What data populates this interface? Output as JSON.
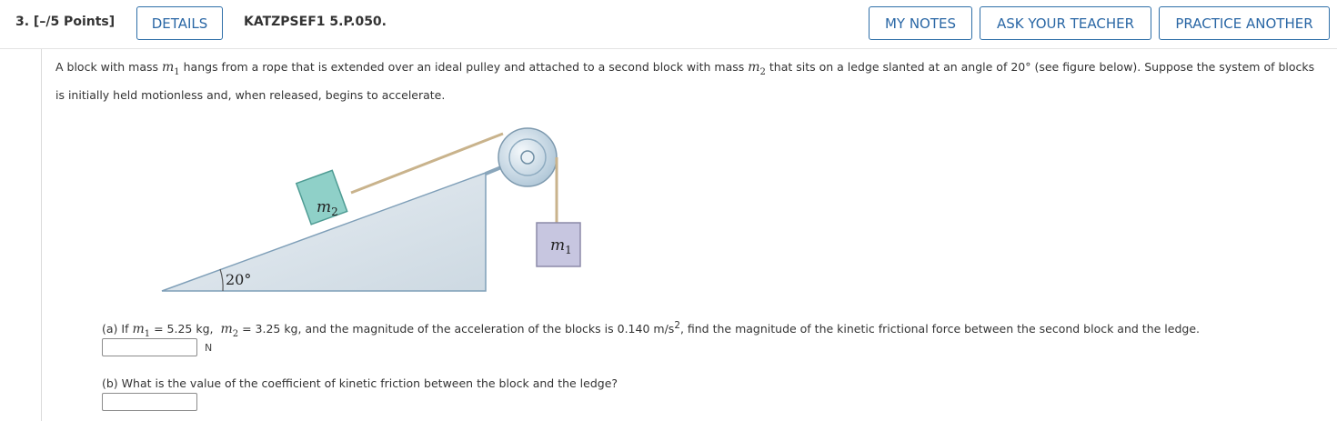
{
  "header": {
    "question_number": "3.  [–/5 Points]",
    "details_label": "DETAILS",
    "question_id": "KATZPSEF1 5.P.050.",
    "my_notes_label": "MY NOTES",
    "ask_teacher_label": "ASK YOUR TEACHER",
    "practice_label": "PRACTICE ANOTHER"
  },
  "prompt": {
    "p1": "A block with mass ",
    "m1": "m",
    "m1_sub": "1",
    "p2": " hangs from a rope that is extended over an ideal pulley and attached to a second block with mass ",
    "m2": "m",
    "m2_sub": "2",
    "p3": " that sits on a ledge slanted at an angle of 20° (see figure below). Suppose the system of blocks is initially held motionless and, when released, begins to accelerate."
  },
  "figure": {
    "block_m2_label": "m",
    "block_m2_sub": "2",
    "block_m1_label": "m",
    "block_m1_sub": "1",
    "angle_label": "20°"
  },
  "part_a": {
    "t1": "(a) If ",
    "m1": "m",
    "m1_sub": "1",
    "t2": " = ",
    "m1_value": "5.25 kg,",
    "m2": "m",
    "m2_sub": "2",
    "t3": " = ",
    "m2_value": "3.25 kg,",
    "t4": " and the magnitude of the acceleration of the blocks is ",
    "accel_value": "0.140",
    "accel_unit": "m/s",
    "accel_exp": "2",
    "t5": ", find the magnitude of the kinetic frictional force between the second block and the ledge.",
    "answer_value": "",
    "unit": "N"
  },
  "part_b": {
    "question": "(b) What is the value of the coefficient of kinetic friction between the block and the ledge?",
    "answer_value": ""
  }
}
